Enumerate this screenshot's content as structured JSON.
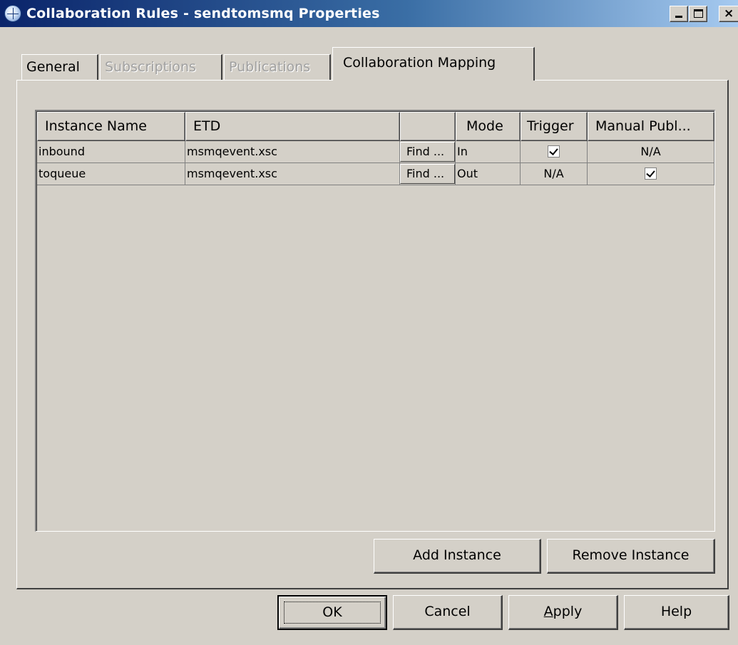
{
  "window": {
    "title": "Collaboration Rules - sendtomsmq Properties",
    "icon": "globe-icon",
    "controls": {
      "minimize": "minimize-icon",
      "maximize": "maximize-icon",
      "close": "×"
    }
  },
  "tabs": [
    {
      "label": "General",
      "enabled": true,
      "selected": false
    },
    {
      "label": "Subscriptions",
      "enabled": false,
      "selected": false
    },
    {
      "label": "Publications",
      "enabled": false,
      "selected": false
    },
    {
      "label": "Collaboration Mapping",
      "enabled": true,
      "selected": true
    }
  ],
  "table": {
    "columns": [
      "Instance Name",
      "ETD",
      "",
      "Mode",
      "Trigger",
      "Manual Publ..."
    ],
    "rows": [
      {
        "instance_name": "inbound",
        "etd": "msmqevent.xsc",
        "find": "Find ...",
        "mode": "In",
        "trigger": true,
        "manual_publish": "N/A"
      },
      {
        "instance_name": "toqueue",
        "etd": "msmqevent.xsc",
        "find": "Find ...",
        "mode": "Out",
        "trigger": "N/A",
        "manual_publish": true
      }
    ]
  },
  "panel_buttons": {
    "add": "Add Instance",
    "remove": "Remove Instance"
  },
  "dialog_buttons": {
    "ok": "OK",
    "cancel": "Cancel",
    "apply_mnemonic": "A",
    "apply_rest": "pply",
    "help": "Help"
  }
}
